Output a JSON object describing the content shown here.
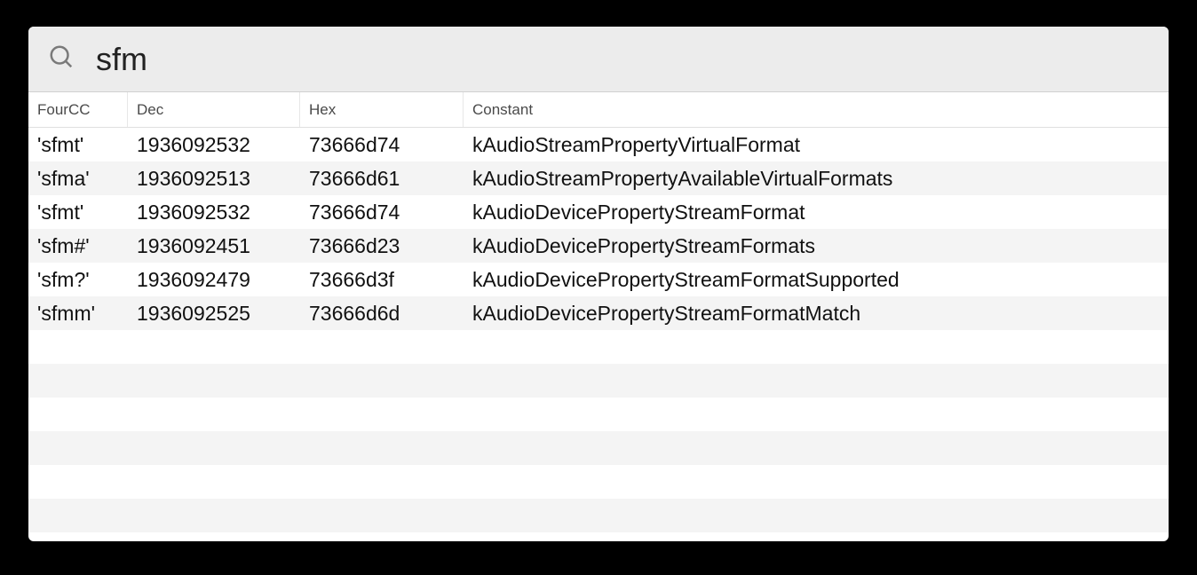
{
  "search": {
    "value": "sfm",
    "placeholder": ""
  },
  "columns": {
    "fourcc": "FourCC",
    "dec": "Dec",
    "hex": "Hex",
    "constant": "Constant"
  },
  "rows": [
    {
      "fourcc": "'sfmt'",
      "dec": "1936092532",
      "hex": "73666d74",
      "constant": "kAudioStreamPropertyVirtualFormat"
    },
    {
      "fourcc": "'sfma'",
      "dec": "1936092513",
      "hex": "73666d61",
      "constant": "kAudioStreamPropertyAvailableVirtualFormats"
    },
    {
      "fourcc": "'sfmt'",
      "dec": "1936092532",
      "hex": "73666d74",
      "constant": "kAudioDevicePropertyStreamFormat"
    },
    {
      "fourcc": "'sfm#'",
      "dec": "1936092451",
      "hex": "73666d23",
      "constant": "kAudioDevicePropertyStreamFormats"
    },
    {
      "fourcc": "'sfm?'",
      "dec": "1936092479",
      "hex": "73666d3f",
      "constant": "kAudioDevicePropertyStreamFormatSupported"
    },
    {
      "fourcc": "'sfmm'",
      "dec": "1936092525",
      "hex": "73666d6d",
      "constant": "kAudioDevicePropertyStreamFormatMatch"
    }
  ],
  "empty_row_count": 6
}
